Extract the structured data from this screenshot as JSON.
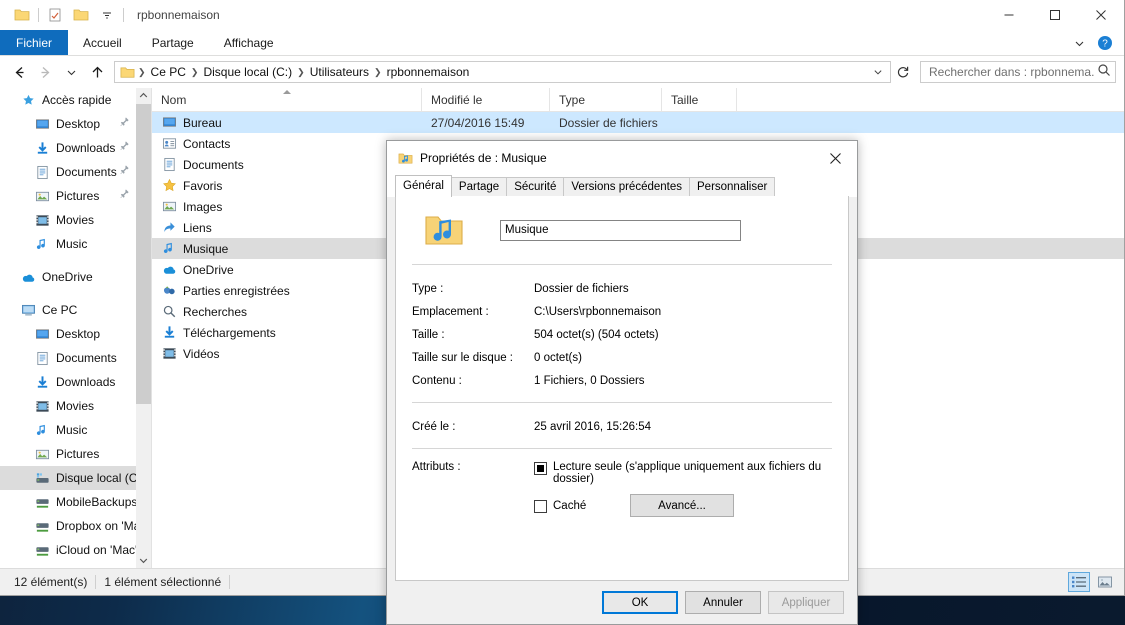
{
  "window": {
    "title": "rpbonnemaison",
    "quick_access": [
      "folder-icon",
      "properties-icon",
      "new-folder-icon",
      "chevron-down-icon"
    ],
    "controls": {
      "minimize": "minimize-icon",
      "maximize": "maximize-icon",
      "close": "close-icon"
    }
  },
  "ribbon": {
    "tabs": [
      {
        "label": "Fichier",
        "active": true
      },
      {
        "label": "Accueil",
        "active": false
      },
      {
        "label": "Partage",
        "active": false
      },
      {
        "label": "Affichage",
        "active": false
      }
    ],
    "collapse_icon": "chevron-down-icon",
    "help_icon": "help-icon"
  },
  "address": {
    "back_icon": "arrow-left-icon",
    "forward_icon": "arrow-right-icon",
    "recent_icon": "chevron-down-icon",
    "up_icon": "arrow-up-icon",
    "breadcrumbs": [
      "Ce PC",
      "Disque local (C:)",
      "Utilisateurs",
      "rpbonnemaison"
    ],
    "dropdown_icon": "chevron-down-icon",
    "refresh_icon": "refresh-icon"
  },
  "search": {
    "placeholder": "Rechercher dans : rpbonnema...",
    "value": "",
    "icon": "search-icon"
  },
  "sidebar": {
    "groups": [
      {
        "header": {
          "label": "Accès rapide",
          "icon": "star-pin-icon"
        },
        "items": [
          {
            "label": "Desktop",
            "icon": "desktop-icon",
            "pinned": true
          },
          {
            "label": "Downloads",
            "icon": "download-icon",
            "pinned": true
          },
          {
            "label": "Documents",
            "icon": "documents-icon",
            "pinned": true
          },
          {
            "label": "Pictures",
            "icon": "pictures-icon",
            "pinned": true
          },
          {
            "label": "Movies",
            "icon": "movies-icon",
            "pinned": false
          },
          {
            "label": "Music",
            "icon": "music-icon",
            "pinned": false
          }
        ]
      },
      {
        "header": {
          "label": "OneDrive",
          "icon": "onedrive-icon"
        },
        "items": []
      },
      {
        "header": {
          "label": "Ce PC",
          "icon": "computer-icon"
        },
        "items": [
          {
            "label": "Desktop",
            "icon": "desktop-icon",
            "pinned": false
          },
          {
            "label": "Documents",
            "icon": "documents-icon",
            "pinned": false
          },
          {
            "label": "Downloads",
            "icon": "download-icon",
            "pinned": false
          },
          {
            "label": "Movies",
            "icon": "movies-icon",
            "pinned": false
          },
          {
            "label": "Music",
            "icon": "music-icon",
            "pinned": false
          },
          {
            "label": "Pictures",
            "icon": "pictures-icon",
            "pinned": false
          },
          {
            "label": "Disque local (C:)",
            "icon": "drive-icon",
            "selected": true
          },
          {
            "label": "MobileBackups ",
            "icon": "network-drive-icon",
            "pinned": false
          },
          {
            "label": "Dropbox on 'Ma",
            "icon": "network-drive-icon",
            "pinned": false
          },
          {
            "label": "iCloud on 'Mac'",
            "icon": "network-drive-icon",
            "pinned": false
          }
        ]
      }
    ],
    "scroll_up_icon": "chevron-up-icon",
    "scroll_down_icon": "chevron-down-icon"
  },
  "filelist": {
    "columns": [
      {
        "label": "Nom",
        "sorted": true
      },
      {
        "label": "Modifié le",
        "sorted": false
      },
      {
        "label": "Type",
        "sorted": false
      },
      {
        "label": "Taille",
        "sorted": false
      }
    ],
    "rows": [
      {
        "name": "Bureau",
        "icon": "desktop-icon",
        "modified": "27/04/2016 15:49",
        "type": "Dossier de fichiers",
        "size": "",
        "state": "blue"
      },
      {
        "name": "Contacts",
        "icon": "contacts-icon",
        "modified": "",
        "type": "",
        "size": "",
        "state": ""
      },
      {
        "name": "Documents",
        "icon": "documents-icon",
        "modified": "",
        "type": "",
        "size": "",
        "state": ""
      },
      {
        "name": "Favoris",
        "icon": "favorites-icon",
        "modified": "",
        "type": "",
        "size": "",
        "state": ""
      },
      {
        "name": "Images",
        "icon": "pictures-icon",
        "modified": "",
        "type": "",
        "size": "",
        "state": ""
      },
      {
        "name": "Liens",
        "icon": "links-icon",
        "modified": "",
        "type": "",
        "size": "",
        "state": ""
      },
      {
        "name": "Musique",
        "icon": "music-icon",
        "modified": "",
        "type": "",
        "size": "",
        "state": "gray"
      },
      {
        "name": "OneDrive",
        "icon": "onedrive-icon",
        "modified": "",
        "type": "",
        "size": "",
        "state": ""
      },
      {
        "name": "Parties enregistrées",
        "icon": "saved-games-icon",
        "modified": "",
        "type": "",
        "size": "",
        "state": ""
      },
      {
        "name": "Recherches",
        "icon": "searches-icon",
        "modified": "",
        "type": "",
        "size": "",
        "state": ""
      },
      {
        "name": "Téléchargements",
        "icon": "download-icon",
        "modified": "",
        "type": "",
        "size": "",
        "state": ""
      },
      {
        "name": "Vidéos",
        "icon": "movies-icon",
        "modified": "",
        "type": "",
        "size": "",
        "state": ""
      }
    ]
  },
  "statusbar": {
    "count": "12 élément(s)",
    "selection": "1 élément sélectionné",
    "views": [
      {
        "name": "details-view",
        "icon": "details-view-icon",
        "active": true
      },
      {
        "name": "thumbnails-view",
        "icon": "thumbnails-view-icon",
        "active": false
      }
    ]
  },
  "dialog": {
    "title": "Propriétés de : Musique",
    "title_icon": "music-folder-icon",
    "close_icon": "close-icon",
    "tabs": [
      {
        "label": "Général",
        "active": true
      },
      {
        "label": "Partage",
        "active": false
      },
      {
        "label": "Sécurité",
        "active": false
      },
      {
        "label": "Versions précédentes",
        "active": false
      },
      {
        "label": "Personnaliser",
        "active": false
      }
    ],
    "folder_icon": "music-folder-icon",
    "name_value": "Musique",
    "properties": [
      {
        "label": "Type :",
        "value": "Dossier de fichiers"
      },
      {
        "label": "Emplacement :",
        "value": "C:\\Users\\rpbonnemaison"
      },
      {
        "label": "Taille :",
        "value": "504 octet(s) (504 octets)"
      },
      {
        "label": "Taille sur le disque :",
        "value": "0 octet(s)"
      },
      {
        "label": "Contenu :",
        "value": "1 Fichiers, 0 Dossiers"
      }
    ],
    "created": {
      "label": "Créé le :",
      "value": "25 avril 2016, 15:26:54"
    },
    "attributes": {
      "label": "Attributs :",
      "readonly": {
        "label": "Lecture seule (s'applique uniquement aux fichiers du dossier)",
        "state": "indeterminate"
      },
      "hidden": {
        "label": "Caché",
        "state": "unchecked"
      },
      "advanced_button": "Avancé..."
    },
    "buttons": {
      "ok": "OK",
      "cancel": "Annuler",
      "apply": "Appliquer",
      "apply_disabled": true
    }
  },
  "colors": {
    "accent": "#0f6cbd",
    "selection_blue": "#cde8ff",
    "selection_gray": "#dcdcdc",
    "focus_ring": "#0078d7"
  }
}
